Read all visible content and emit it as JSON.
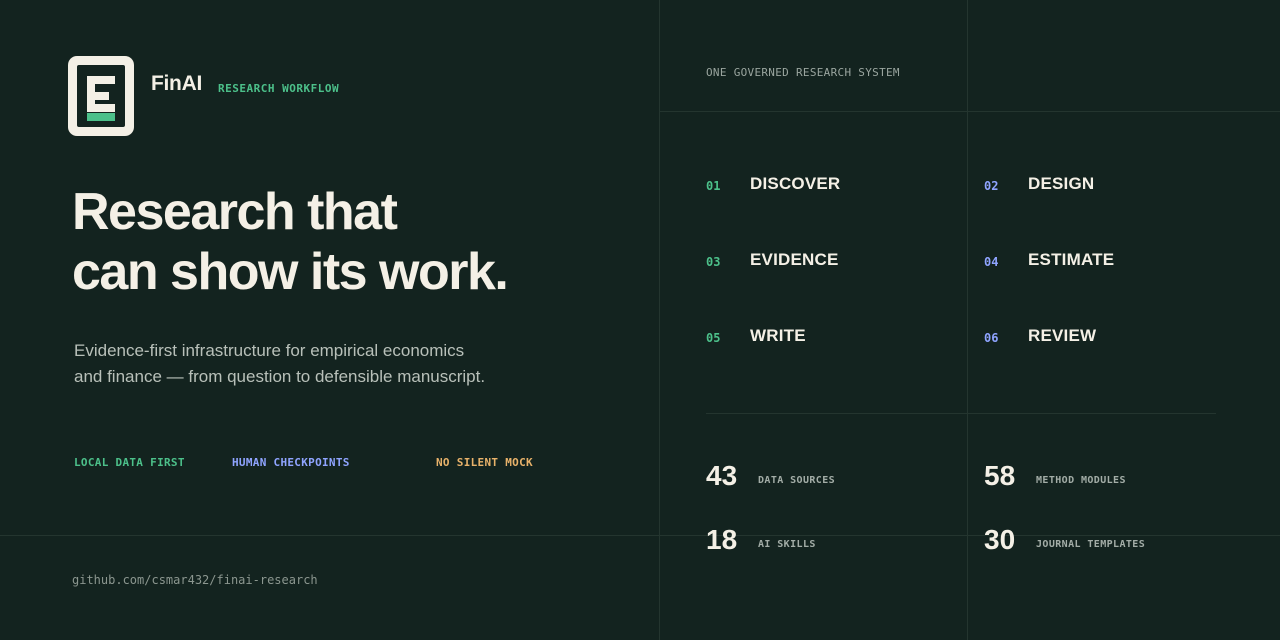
{
  "brand": {
    "icon": "document-logo-icon",
    "name": "FinAI",
    "tag": "RESEARCH WORKFLOW"
  },
  "headline": {
    "line1": "Research that",
    "line2": "can show its work."
  },
  "subtitle": {
    "line1": "Evidence-first infrastructure for empirical economics",
    "line2": "and finance — from question to defensible manuscript."
  },
  "tags": [
    {
      "label": "LOCAL DATA FIRST",
      "color": "#4cc08a"
    },
    {
      "label": "HUMAN CHECKPOINTS",
      "color": "#8fa4ff"
    },
    {
      "label": "NO SILENT MOCK",
      "color": "#e8b26a"
    }
  ],
  "repo_url": "github.com/csmar432/finai-research",
  "system_label": "ONE GOVERNED RESEARCH SYSTEM",
  "steps": [
    {
      "num": "01",
      "label": "DISCOVER",
      "color": "#4cc08a"
    },
    {
      "num": "02",
      "label": "DESIGN",
      "color": "#8fa4ff"
    },
    {
      "num": "03",
      "label": "EVIDENCE",
      "color": "#4cc08a"
    },
    {
      "num": "04",
      "label": "ESTIMATE",
      "color": "#8fa4ff"
    },
    {
      "num": "05",
      "label": "WRITE",
      "color": "#4cc08a"
    },
    {
      "num": "06",
      "label": "REVIEW",
      "color": "#8fa4ff"
    }
  ],
  "stats": [
    {
      "value": "43",
      "label": "DATA SOURCES"
    },
    {
      "value": "58",
      "label": "METHOD MODULES"
    },
    {
      "value": "18",
      "label": "AI SKILLS"
    },
    {
      "value": "30",
      "label": "JOURNAL TEMPLATES"
    }
  ],
  "colors": {
    "background": "#13231f",
    "text": "#f4f0e6",
    "accent_green": "#4cc08a",
    "accent_blue": "#8fa4ff",
    "accent_amber": "#e8b26a"
  }
}
